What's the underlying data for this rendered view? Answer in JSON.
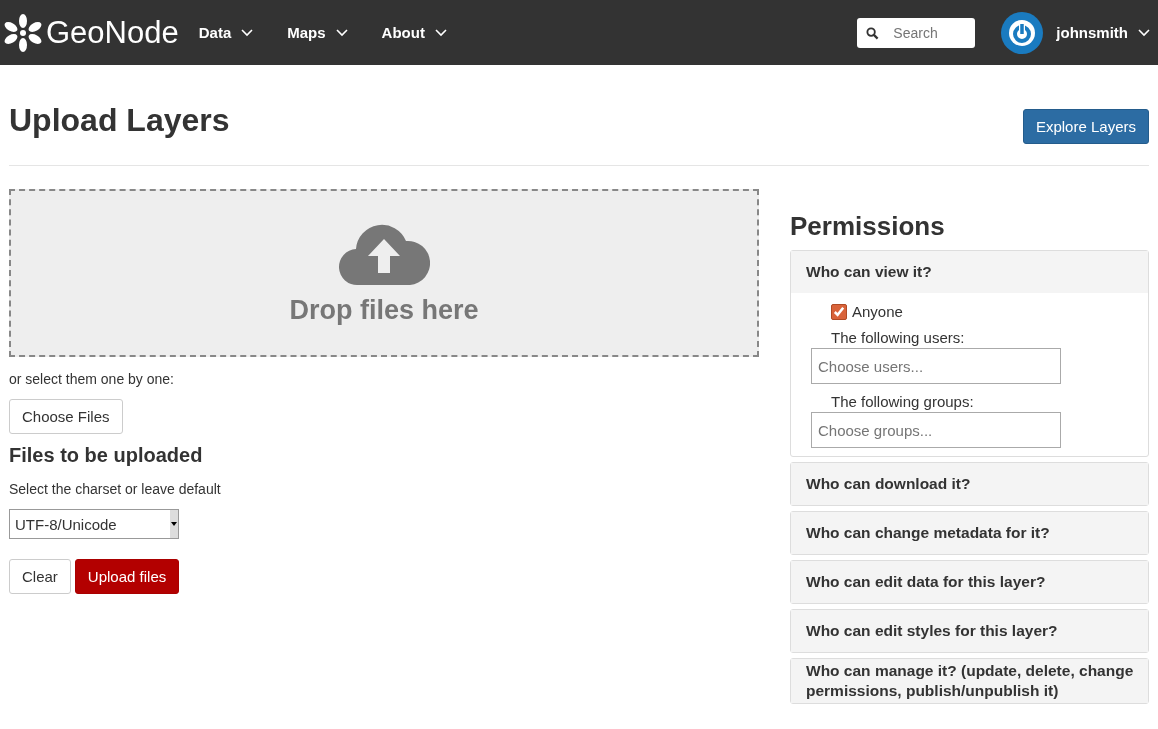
{
  "navbar": {
    "brand": "GeoNode",
    "menus": [
      {
        "label": "Data"
      },
      {
        "label": "Maps"
      },
      {
        "label": "About"
      }
    ],
    "search": {
      "placeholder": "Search"
    },
    "user": "johnsmith"
  },
  "header": {
    "title": "Upload Layers",
    "button": "Explore Layers"
  },
  "upload": {
    "drop_text": "Drop files here",
    "select_hint": "or select them one by one:",
    "choose_button": "Choose Files",
    "files_heading": "Files to be uploaded",
    "charset_label": "Select the charset or leave default",
    "charset_value": "UTF-8/Unicode",
    "clear_button": "Clear",
    "upload_button": "Upload files"
  },
  "permissions": {
    "title": "Permissions",
    "panels": [
      {
        "title": "Who can view it?",
        "expanded": true,
        "anyone_label": "Anyone",
        "anyone_checked": true,
        "users_label": "The following users:",
        "users_placeholder": "Choose users...",
        "groups_label": "The following groups:",
        "groups_placeholder": "Choose groups..."
      },
      {
        "title": "Who can download it?",
        "expanded": false
      },
      {
        "title": "Who can change metadata for it?",
        "expanded": false
      },
      {
        "title": "Who can edit data for this layer?",
        "expanded": false
      },
      {
        "title": "Who can edit styles for this layer?",
        "expanded": false
      },
      {
        "title": "Who can manage it? (update, delete, change permissions, publish/unpublish it)",
        "expanded": false
      }
    ]
  }
}
